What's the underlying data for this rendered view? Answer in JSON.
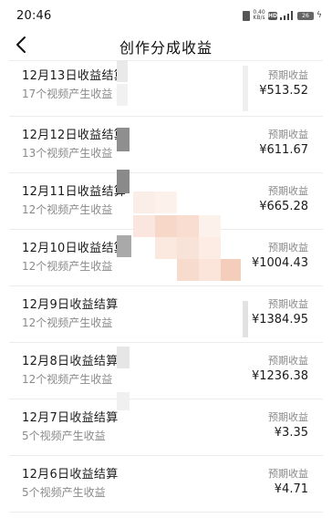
{
  "status_bar": {
    "time": "20:46",
    "net_speed": "0.40 KB/s",
    "hd_label": "HD",
    "signal_label": "5G",
    "battery": "26"
  },
  "nav": {
    "title": "创作分成收益"
  },
  "list": {
    "expect_label": "预期收益",
    "items": [
      {
        "title": "12月13日收益结算",
        "sub": "17个视频产生收益",
        "amount": "¥513.52"
      },
      {
        "title": "12月12日收益结算",
        "sub": "13个视频产生收益",
        "amount": "¥611.67"
      },
      {
        "title": "12月11日收益结算",
        "sub": "12个视频产生收益",
        "amount": "¥665.28"
      },
      {
        "title": "12月10日收益结算",
        "sub": "12个视频产生收益",
        "amount": "¥1004.43"
      },
      {
        "title": "12月9日收益结算",
        "sub": "12个视频产生收益",
        "amount": "¥1384.95"
      },
      {
        "title": "12月8日收益结算",
        "sub": "12个视频产生收益",
        "amount": "¥1236.38"
      },
      {
        "title": "12月7日收益结算",
        "sub": "5个视频产生收益",
        "amount": "¥3.35"
      },
      {
        "title": "12月6日收益结算",
        "sub": "5个视频产生收益",
        "amount": "¥4.71"
      }
    ]
  }
}
